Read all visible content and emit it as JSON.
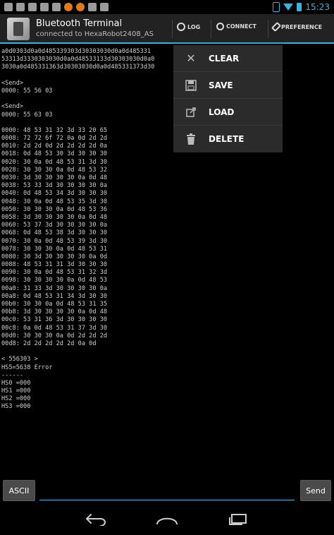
{
  "status_bar": {
    "time": "15:23",
    "left_icons": [
      "sim-icon",
      "photo-icon",
      "tool-icon",
      "mail-icon",
      "download-icon",
      "browser-icon",
      "browser-icon",
      "mail-icon",
      "usb-icon"
    ],
    "colors": {
      "accent": "#33b5e5",
      "notification_orange": "#e07a1e"
    }
  },
  "action_bar": {
    "title": "Bluetooth Terminal",
    "subtitle": "connected to HexaRobot2408_AS",
    "actions": [
      {
        "label": "LOG",
        "icon": "log-icon"
      },
      {
        "label": "CONNECT",
        "icon": "search-icon"
      },
      {
        "label": "PREFERENCE",
        "icon": "wrench-icon"
      }
    ]
  },
  "menu": {
    "items": [
      {
        "label": "CLEAR",
        "icon": "close-icon"
      },
      {
        "label": "SAVE",
        "icon": "save-icon"
      },
      {
        "label": "LOAD",
        "icon": "load-icon"
      },
      {
        "label": "DELETE",
        "icon": "trash-icon"
      }
    ]
  },
  "log": {
    "lines": [
      "a0d0303d0a0d485339303d30303030d0a0d485331",
      "53313d3330303030d0a0d48533133d30303030d0a0",
      "3030a0d485331363d30303030d0a0d485331373d30",
      "",
      "<Send>",
      "0000: 55 56 03",
      "",
      "<Send>",
      "0000: 55 63 03",
      "",
      "0000: 48 53 31 32 3d 33 20 65",
      "0008: 72 72 6f 72 0a 0d 2d 2d",
      "0010: 2d 2d 0d 2d 2d 2d 2d 0a",
      "0018: 0d 48 53 30 3d 30 30 30",
      "0020: 30 0a 0d 48 53 31 3d 30",
      "0028: 30 30 30 0a 0d 48 53 32",
      "0030: 3d 30 30 30 30 0a 0d 48",
      "0038: 53 33 3d 30 30 30 30 0a",
      "0040: 0d 48 53 34 3d 30 30 30",
      "0048: 30 0a 0d 48 53 35 3d 30",
      "0050: 30 30 30 0a 0d 48 53 36",
      "0058: 3d 30 30 30 30 0a 0d 48",
      "0060: 53 37 3d 30 30 30 30 0a",
      "0068: 0d 48 53 38 3d 30 30 30",
      "0070: 30 0a 0d 48 53 39 3d 30",
      "0078: 30 30 30 0a 0d 48 53 31",
      "0080: 30 3d 30 30 30 30 0a 0d",
      "0088: 48 53 31 31 3d 30 30 30",
      "0090: 30 0a 0d 48 53 31 32 3d",
      "0098: 30 30 30 30 0a 0d 48 53",
      "00a0: 31 33 3d 30 30 30 30 0a",
      "00a8: 0d 48 53 31 34 3d 30 30",
      "00b0: 30 30 0a 0d 48 53 31 35",
      "00b8: 3d 30 30 30 30 0a 0d 48",
      "00c0: 53 31 36 3d 30 30 30 30",
      "00c8: 0a 0d 48 53 31 37 3d 30",
      "00d0: 30 30 30 0a 0d 2d 2d 2d",
      "00d8: 2d 2d 2d 2d 2d 0a 0d",
      "",
      "< 556303 >",
      "HS5=5638 Error",
      "------",
      "HS0 =000",
      "HS1 =000",
      "HS2 =000",
      "HS3 =000"
    ]
  },
  "input_bar": {
    "mode_button": "ASCII",
    "input_value": "",
    "send_button": "Send"
  },
  "nav_bar": {
    "buttons": [
      "back-icon",
      "home-icon",
      "recent-apps-icon"
    ]
  }
}
